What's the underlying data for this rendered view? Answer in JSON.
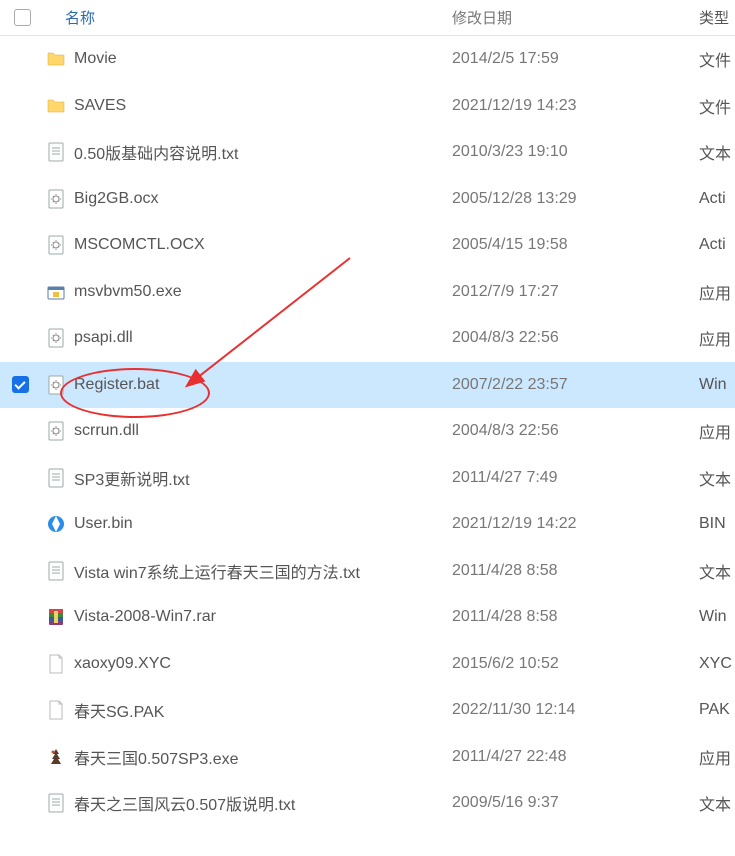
{
  "headers": {
    "name": "名称",
    "date": "修改日期",
    "type": "类型"
  },
  "files": [
    {
      "name": "Movie",
      "date": "2014/2/5 17:59",
      "type": "文件",
      "icon": "folder",
      "selected": false
    },
    {
      "name": "SAVES",
      "date": "2021/12/19 14:23",
      "type": "文件",
      "icon": "folder",
      "selected": false
    },
    {
      "name": "0.50版基础内容说明.txt",
      "date": "2010/3/23 19:10",
      "type": "文本",
      "icon": "txt",
      "selected": false
    },
    {
      "name": "Big2GB.ocx",
      "date": "2005/12/28 13:29",
      "type": "Acti",
      "icon": "ocx",
      "selected": false
    },
    {
      "name": "MSCOMCTL.OCX",
      "date": "2005/4/15 19:58",
      "type": "Acti",
      "icon": "ocx",
      "selected": false
    },
    {
      "name": "msvbvm50.exe",
      "date": "2012/7/9 17:27",
      "type": "应用",
      "icon": "exe-box",
      "selected": false
    },
    {
      "name": "psapi.dll",
      "date": "2004/8/3 22:56",
      "type": "应用",
      "icon": "dll",
      "selected": false
    },
    {
      "name": "Register.bat",
      "date": "2007/2/22 23:57",
      "type": "Win",
      "icon": "bat",
      "selected": true
    },
    {
      "name": "scrrun.dll",
      "date": "2004/8/3 22:56",
      "type": "应用",
      "icon": "dll",
      "selected": false
    },
    {
      "name": "SP3更新说明.txt",
      "date": "2011/4/27 7:49",
      "type": "文本",
      "icon": "txt",
      "selected": false
    },
    {
      "name": "User.bin",
      "date": "2021/12/19 14:22",
      "type": "BIN",
      "icon": "bin",
      "selected": false
    },
    {
      "name": "Vista win7系统上运行春天三国的方法.txt",
      "date": "2011/4/28 8:58",
      "type": "文本",
      "icon": "txt",
      "selected": false
    },
    {
      "name": "Vista-2008-Win7.rar",
      "date": "2011/4/28 8:58",
      "type": "Win",
      "icon": "rar",
      "selected": false
    },
    {
      "name": "xaoxy09.XYC",
      "date": "2015/6/2 10:52",
      "type": "XYC",
      "icon": "blank",
      "selected": false
    },
    {
      "name": "春天SG.PAK",
      "date": "2022/11/30 12:14",
      "type": "PAK",
      "icon": "blank",
      "selected": false
    },
    {
      "name": "春天三国0.507SP3.exe",
      "date": "2011/4/27 22:48",
      "type": "应用",
      "icon": "exe-app",
      "selected": false
    },
    {
      "name": "春天之三国风云0.507版说明.txt",
      "date": "2009/5/16 9:37",
      "type": "文本",
      "icon": "txt",
      "selected": false
    }
  ],
  "icons": {
    "folder": "folder-icon",
    "txt": "txt-file-icon",
    "ocx": "ocx-file-icon",
    "dll": "dll-file-icon",
    "exe-box": "exe-installer-icon",
    "bat": "bat-file-icon",
    "bin": "bin-file-icon",
    "rar": "rar-archive-icon",
    "blank": "blank-file-icon",
    "exe-app": "exe-app-icon"
  }
}
